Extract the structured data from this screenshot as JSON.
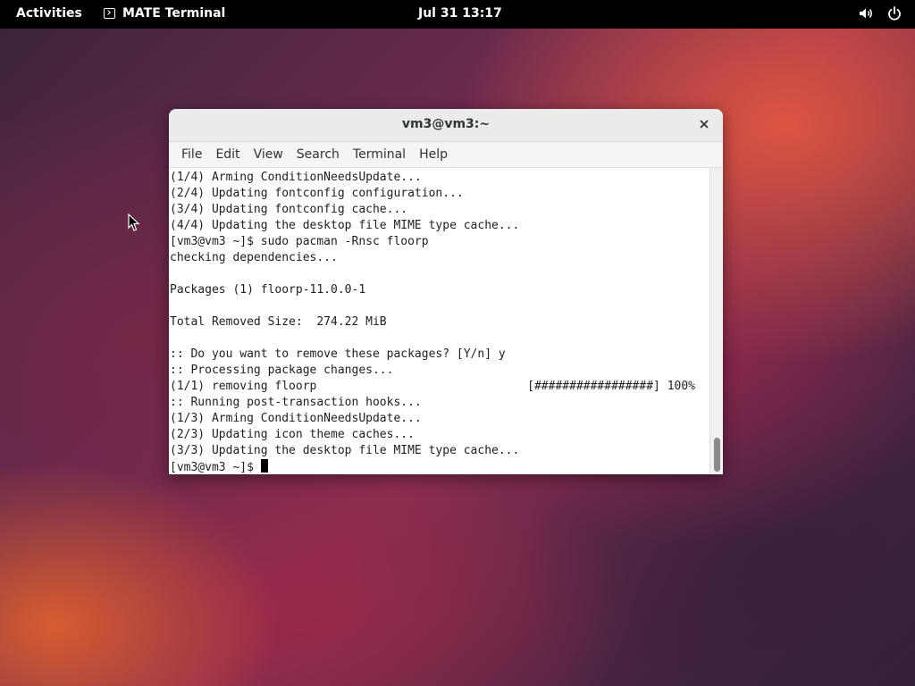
{
  "topbar": {
    "activities_label": "Activities",
    "app_name": "MATE Terminal",
    "clock": "Jul 31  13:17",
    "icons": [
      "terminal-icon",
      "volume-icon",
      "power-icon"
    ]
  },
  "window": {
    "title": "vm3@vm3:~",
    "menu": [
      "File",
      "Edit",
      "View",
      "Search",
      "Terminal",
      "Help"
    ],
    "lines": [
      "(1/4) Arming ConditionNeedsUpdate...",
      "(2/4) Updating fontconfig configuration...",
      "(3/4) Updating fontconfig cache...",
      "(4/4) Updating the desktop file MIME type cache...",
      "[vm3@vm3 ~]$ sudo pacman -Rnsc floorp",
      "checking dependencies...",
      "",
      "Packages (1) floorp-11.0.0-1",
      "",
      "Total Removed Size:  274.22 MiB",
      "",
      ":: Do you want to remove these packages? [Y/n] y",
      ":: Processing package changes...",
      "(1/1) removing floorp",
      ":: Running post-transaction hooks...",
      "(1/3) Arming ConditionNeedsUpdate...",
      "(2/3) Updating icon theme caches...",
      "(3/3) Updating the desktop file MIME type cache...",
      "[vm3@vm3 ~]$ "
    ],
    "progress_text": "[#################] 100%",
    "progress_percent": 100
  }
}
